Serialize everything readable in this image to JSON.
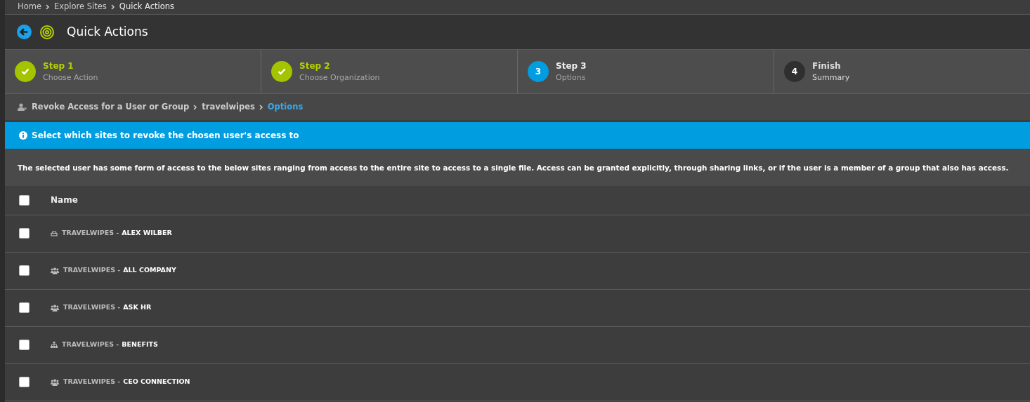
{
  "breadcrumb": [
    "Home",
    "Explore Sites",
    "Quick Actions"
  ],
  "header": {
    "title": "Quick Actions"
  },
  "steps": [
    {
      "title": "Step 1",
      "subtitle": "Choose Action",
      "completed": true,
      "selected": false
    },
    {
      "title": "Step 2",
      "subtitle": "Choose Organization",
      "completed": true,
      "selected": false
    },
    {
      "number": "3",
      "title": "Step 3",
      "subtitle": "Options",
      "completed": false,
      "selected": true
    },
    {
      "number": "4",
      "title": "Finish",
      "subtitle": "Summary",
      "completed": false,
      "selected": false
    }
  ],
  "path": [
    {
      "label": "Revoke Access for a User or Group",
      "selected": false
    },
    {
      "label": "travelwipes",
      "selected": false
    },
    {
      "label": "Options",
      "selected": true
    }
  ],
  "banner": "Select which sites to revoke the chosen user's access to",
  "description": "The selected user has some form of access to the below sites ranging from access to the entire site to access to a single file. Access can be granted explicitly, through sharing links, or if the user is a member of a group that also has access.",
  "table": {
    "select_all_checked": false,
    "columns": [
      "Name"
    ],
    "rows": [
      {
        "kind": "personal",
        "prefix": "TRAVELWIPES -",
        "name": "ALEX WILBER",
        "checked": false
      },
      {
        "kind": "group",
        "prefix": "TRAVELWIPES -",
        "name": "ALL COMPANY",
        "checked": false
      },
      {
        "kind": "group",
        "prefix": "TRAVELWIPES -",
        "name": "ASK HR",
        "checked": false
      },
      {
        "kind": "hierarchy",
        "prefix": "TRAVELWIPES -",
        "name": "BENEFITS",
        "checked": false
      },
      {
        "kind": "group",
        "prefix": "TRAVELWIPES -",
        "name": "CEO CONNECTION",
        "checked": false
      }
    ]
  }
}
